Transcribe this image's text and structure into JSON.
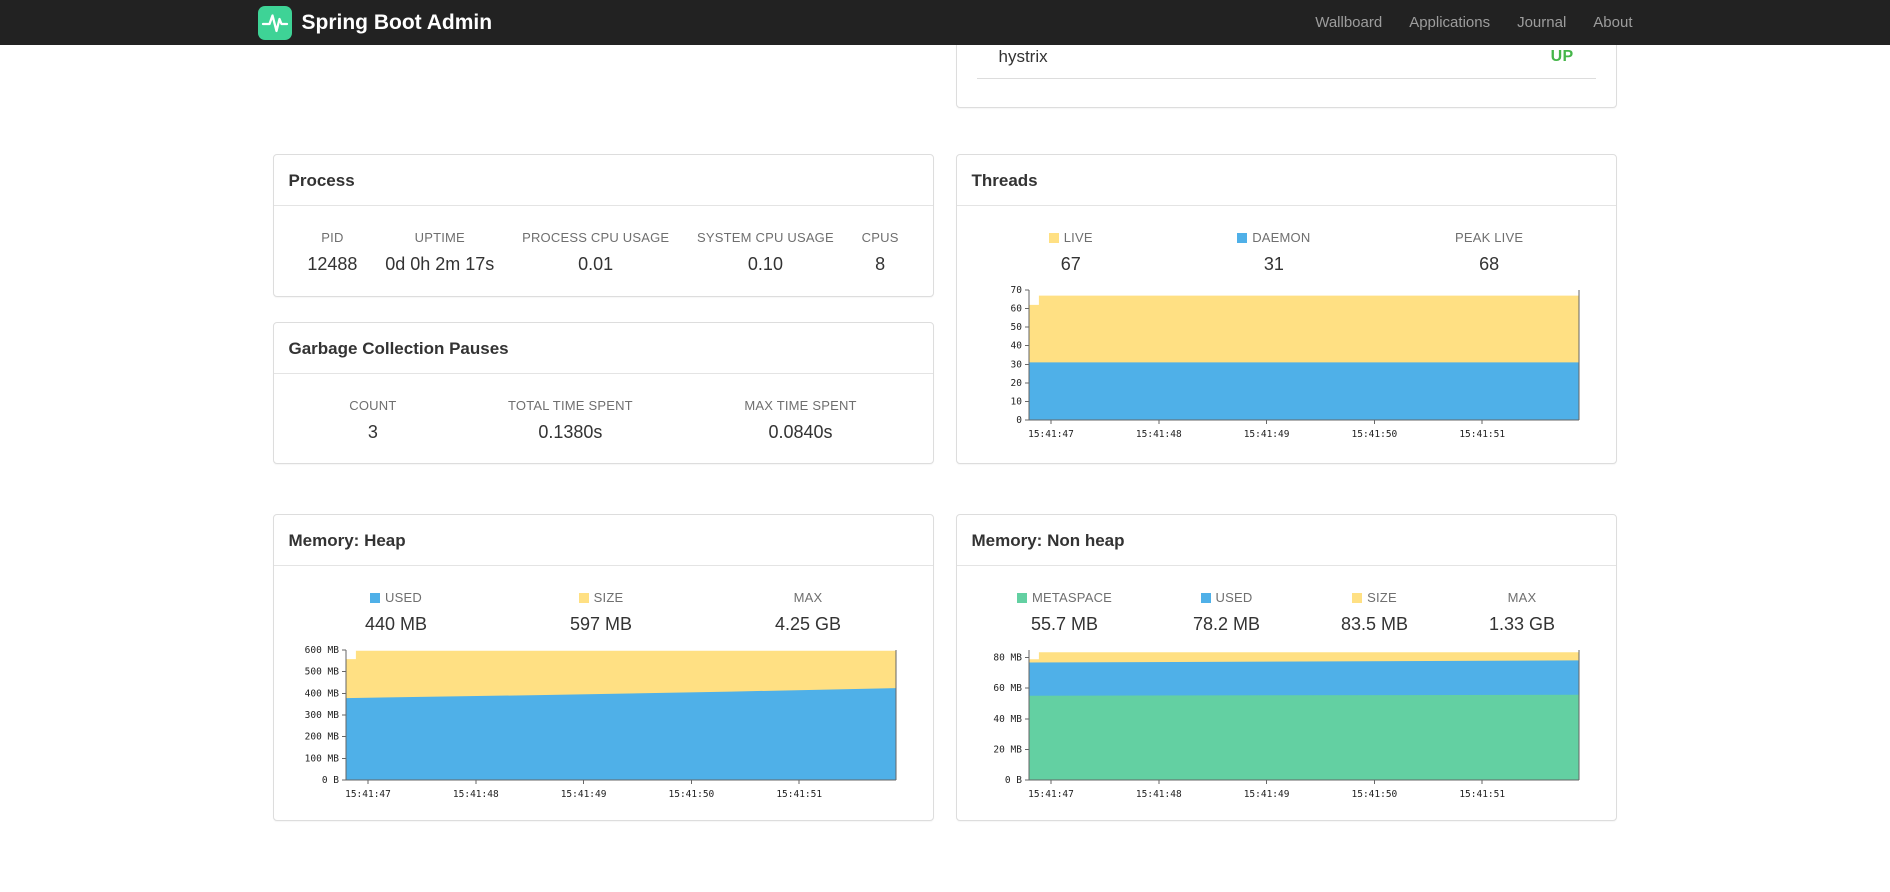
{
  "navbar": {
    "brand": "Spring Boot Admin",
    "logo_color": "#3ed396",
    "links": [
      "Wallboard",
      "Applications",
      "Journal",
      "About"
    ]
  },
  "application_row": {
    "name": "hystrix",
    "status": "UP",
    "status_color": "#45b649"
  },
  "panels": {
    "process": {
      "title": "Process",
      "metrics": [
        {
          "label": "PID",
          "value": "12488"
        },
        {
          "label": "UPTIME",
          "value": "0d 0h 2m 17s"
        },
        {
          "label": "PROCESS CPU USAGE",
          "value": "0.01"
        },
        {
          "label": "SYSTEM CPU USAGE",
          "value": "0.10"
        },
        {
          "label": "CPUS",
          "value": "8"
        }
      ]
    },
    "gc": {
      "title": "Garbage Collection Pauses",
      "metrics": [
        {
          "label": "COUNT",
          "value": "3"
        },
        {
          "label": "TOTAL TIME SPENT",
          "value": "0.1380s"
        },
        {
          "label": "MAX TIME SPENT",
          "value": "0.0840s"
        }
      ]
    },
    "threads": {
      "title": "Threads",
      "metrics": [
        {
          "label": "LIVE",
          "value": "67"
        },
        {
          "label": "DAEMON",
          "value": "31"
        },
        {
          "label": "PEAK LIVE",
          "value": "68"
        }
      ]
    },
    "heap": {
      "title": "Memory: Heap",
      "metrics": [
        {
          "label": "USED",
          "value": "440 MB"
        },
        {
          "label": "SIZE",
          "value": "597 MB"
        },
        {
          "label": "MAX",
          "value": "4.25 GB"
        }
      ]
    },
    "nonheap": {
      "title": "Memory: Non heap",
      "metrics": [
        {
          "label": "METASPACE",
          "value": "55.7 MB"
        },
        {
          "label": "USED",
          "value": "78.2 MB"
        },
        {
          "label": "SIZE",
          "value": "83.5 MB"
        },
        {
          "label": "MAX",
          "value": "1.33 GB"
        }
      ]
    }
  },
  "chart_data": {
    "threads": {
      "type": "area",
      "title": "Threads",
      "ylim": [
        0,
        70
      ],
      "axis_color": "#666666",
      "yticks": [
        {
          "v": 0,
          "label": "0"
        },
        {
          "v": 10,
          "label": "10"
        },
        {
          "v": 20,
          "label": "20"
        },
        {
          "v": 30,
          "label": "30"
        },
        {
          "v": 40,
          "label": "40"
        },
        {
          "v": 50,
          "label": "50"
        },
        {
          "v": 60,
          "label": "60"
        },
        {
          "v": 70,
          "label": "70"
        }
      ],
      "x_labels": [
        "15:41:47",
        "15:41:48",
        "15:41:49",
        "15:41:50",
        "15:41:51"
      ],
      "x_fractions": [
        0.04,
        0.236,
        0.432,
        0.628,
        0.824
      ],
      "series": [
        {
          "name": "LIVE",
          "color": "#ffe083",
          "points": [
            [
              0,
              62
            ],
            [
              0.018,
              62
            ],
            [
              0.018,
              67
            ],
            [
              1,
              67
            ]
          ]
        },
        {
          "name": "DAEMON",
          "color": "#4fb0e8",
          "points": [
            [
              0,
              31
            ],
            [
              1,
              31
            ]
          ]
        }
      ]
    },
    "heap": {
      "type": "area",
      "title": "Memory: Heap",
      "ylim": [
        0,
        600
      ],
      "axis_color": "#666666",
      "yticks": [
        {
          "v": 0,
          "label": "0 B"
        },
        {
          "v": 100,
          "label": "100 MB"
        },
        {
          "v": 200,
          "label": "200 MB"
        },
        {
          "v": 300,
          "label": "300 MB"
        },
        {
          "v": 400,
          "label": "400 MB"
        },
        {
          "v": 500,
          "label": "500 MB"
        },
        {
          "v": 600,
          "label": "600 MB"
        }
      ],
      "x_labels": [
        "15:41:47",
        "15:41:48",
        "15:41:49",
        "15:41:50",
        "15:41:51"
      ],
      "x_fractions": [
        0.04,
        0.236,
        0.432,
        0.628,
        0.824
      ],
      "series": [
        {
          "name": "SIZE",
          "color": "#ffe083",
          "points": [
            [
              0,
              558
            ],
            [
              0.018,
              558
            ],
            [
              0.018,
              597
            ],
            [
              1,
              597
            ]
          ]
        },
        {
          "name": "USED",
          "color": "#4fb0e8",
          "points": [
            [
              0,
              378
            ],
            [
              0.35,
              392
            ],
            [
              0.7,
              408
            ],
            [
              1,
              424
            ]
          ]
        }
      ]
    },
    "nonheap": {
      "type": "area",
      "title": "Memory: Non heap",
      "ylim": [
        0,
        85
      ],
      "axis_color": "#666666",
      "yticks": [
        {
          "v": 0,
          "label": "0 B"
        },
        {
          "v": 20,
          "label": "20 MB"
        },
        {
          "v": 40,
          "label": "40 MB"
        },
        {
          "v": 60,
          "label": "60 MB"
        },
        {
          "v": 80,
          "label": "80 MB"
        }
      ],
      "x_labels": [
        "15:41:47",
        "15:41:48",
        "15:41:49",
        "15:41:50",
        "15:41:51"
      ],
      "x_fractions": [
        0.04,
        0.236,
        0.432,
        0.628,
        0.824
      ],
      "series": [
        {
          "name": "SIZE",
          "color": "#ffe083",
          "points": [
            [
              0,
              79
            ],
            [
              0.018,
              79
            ],
            [
              0.018,
              83.5
            ],
            [
              1,
              83.5
            ]
          ]
        },
        {
          "name": "USED",
          "color": "#4fb0e8",
          "points": [
            [
              0,
              76.8
            ],
            [
              0.5,
              77.5
            ],
            [
              1,
              78.2
            ]
          ]
        },
        {
          "name": "METASPACE",
          "color": "#63d0a2",
          "points": [
            [
              0,
              55.1
            ],
            [
              1,
              55.7
            ]
          ]
        }
      ]
    }
  }
}
